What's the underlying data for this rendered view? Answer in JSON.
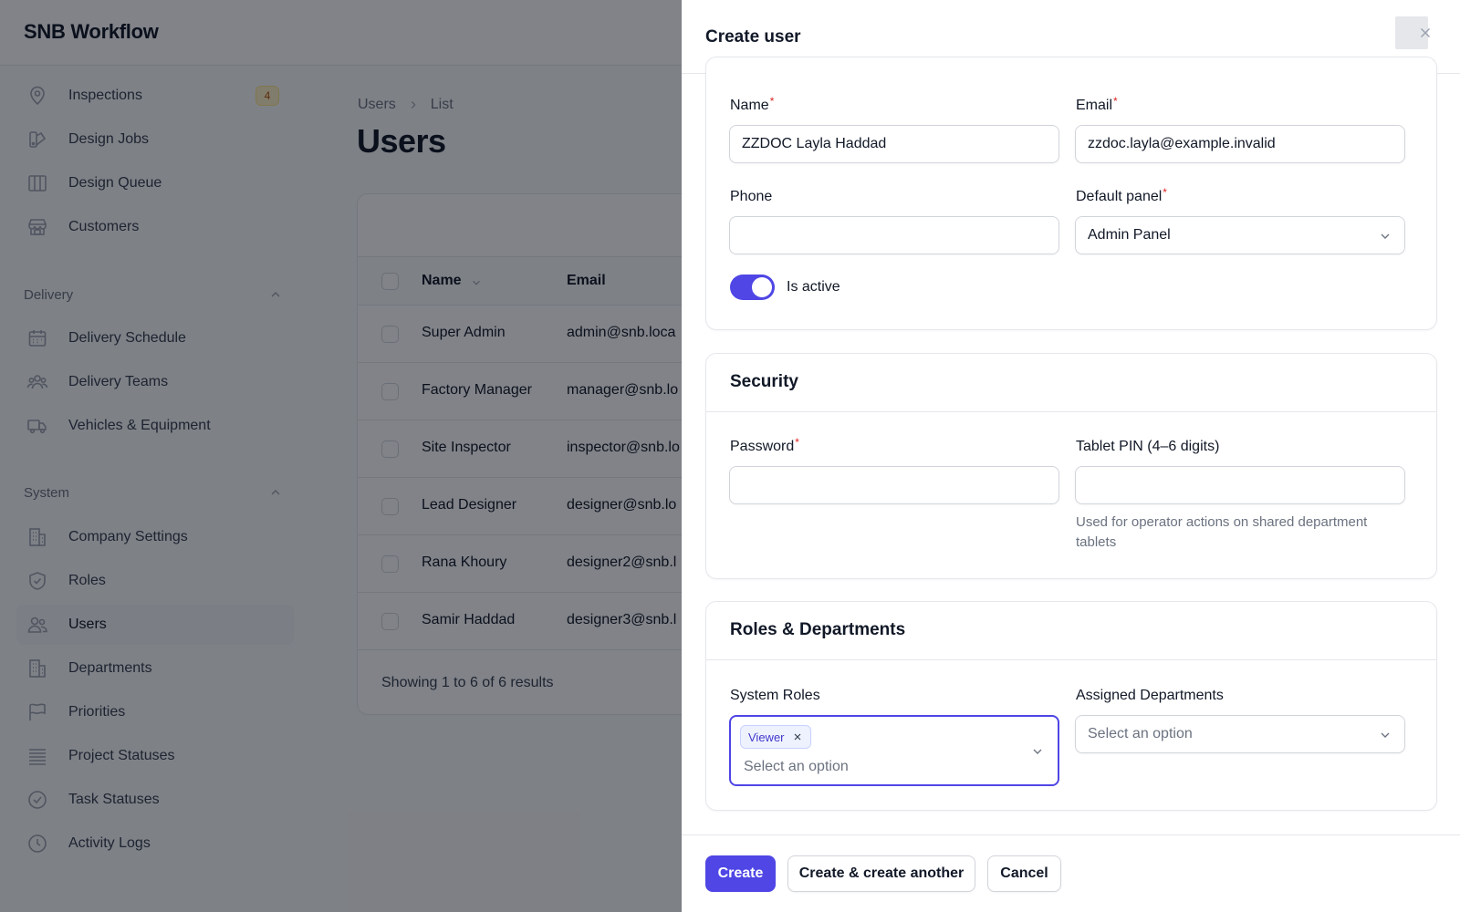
{
  "app": {
    "title": "SNB Workflow"
  },
  "sidebar": {
    "items_top": [
      {
        "label": "Inspections",
        "icon": "map-pin-icon",
        "badge": "4"
      },
      {
        "label": "Design Jobs",
        "icon": "design-icon"
      },
      {
        "label": "Design Queue",
        "icon": "columns-icon"
      },
      {
        "label": "Customers",
        "icon": "store-icon"
      }
    ],
    "groups": [
      {
        "label": "Delivery",
        "items": [
          {
            "label": "Delivery Schedule",
            "icon": "calendar-icon"
          },
          {
            "label": "Delivery Teams",
            "icon": "team-icon"
          },
          {
            "label": "Vehicles & Equipment",
            "icon": "truck-icon"
          }
        ]
      },
      {
        "label": "System",
        "items": [
          {
            "label": "Company Settings",
            "icon": "building-icon"
          },
          {
            "label": "Roles",
            "icon": "shield-icon"
          },
          {
            "label": "Users",
            "icon": "users-icon",
            "active": true
          },
          {
            "label": "Departments",
            "icon": "building-icon"
          },
          {
            "label": "Priorities",
            "icon": "flag-icon"
          },
          {
            "label": "Project Statuses",
            "icon": "list-icon"
          },
          {
            "label": "Task Statuses",
            "icon": "check-circle-icon"
          },
          {
            "label": "Activity Logs",
            "icon": "clock-icon"
          }
        ]
      }
    ]
  },
  "breadcrumb": [
    "Users",
    "List"
  ],
  "page": {
    "title": "Users"
  },
  "table": {
    "columns": [
      "Name",
      "Email"
    ],
    "rows": [
      {
        "name": "Super Admin",
        "email": "admin@snb.loca"
      },
      {
        "name": "Factory Manager",
        "email": "manager@snb.lo"
      },
      {
        "name": "Site Inspector",
        "email": "inspector@snb.lo"
      },
      {
        "name": "Lead Designer",
        "email": "designer@snb.lo"
      },
      {
        "name": "Rana Khoury",
        "email": "designer2@snb.l"
      },
      {
        "name": "Samir Haddad",
        "email": "designer3@snb.l"
      }
    ],
    "footer": "Showing 1 to 6 of 6 results"
  },
  "modal": {
    "title": "Create user",
    "close_icon": "close-icon",
    "fields": {
      "name": {
        "label": "Name",
        "required": "*",
        "value": "ZZDOC Layla Haddad"
      },
      "email": {
        "label": "Email",
        "required": "*",
        "value": "zzdoc.layla@example.invalid"
      },
      "phone": {
        "label": "Phone",
        "value": ""
      },
      "default_panel": {
        "label": "Default panel",
        "required": "*",
        "value": "Admin Panel"
      },
      "is_active": {
        "label": "Is active",
        "checked": true
      }
    },
    "security": {
      "title": "Security",
      "password": {
        "label": "Password",
        "required": "*",
        "value": ""
      },
      "pin": {
        "label": "Tablet PIN (4–6 digits)",
        "value": "",
        "hint": "Used for operator actions on shared department tablets"
      }
    },
    "roles_departments": {
      "title": "Roles & Departments",
      "system_roles": {
        "label": "System Roles",
        "selected": [
          "Viewer"
        ],
        "placeholder": "Select an option"
      },
      "assigned_departments": {
        "label": "Assigned Departments",
        "placeholder": "Select an option"
      }
    },
    "buttons": {
      "create": "Create",
      "create_another": "Create & create another",
      "cancel": "Cancel"
    }
  },
  "colors": {
    "primary": "#4f46e5",
    "required": "#dc2626",
    "overlay": "rgba(3,7,18,0.5)"
  }
}
